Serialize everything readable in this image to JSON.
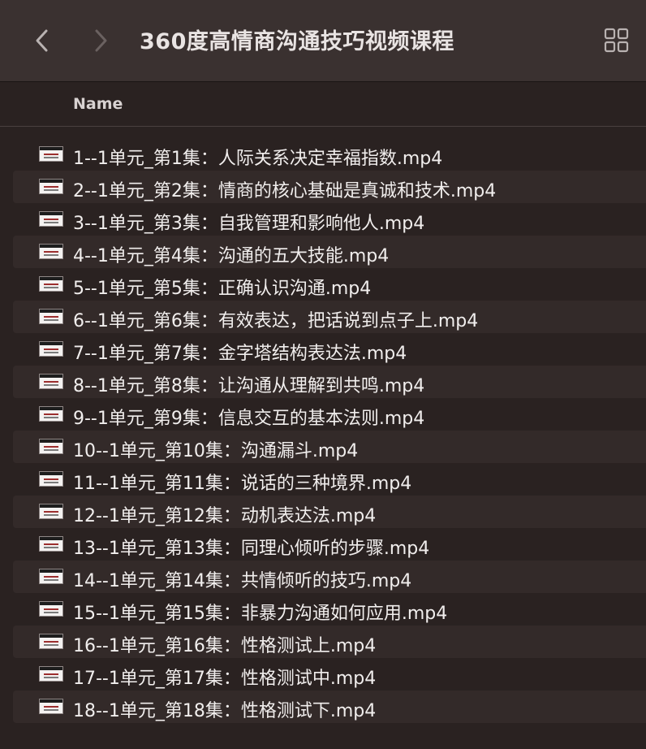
{
  "window": {
    "title": "360度高情商沟通技巧视频课程"
  },
  "toolbar": {
    "back_icon": "chevron-left-icon",
    "forward_icon": "chevron-right-icon",
    "view_icon": "grid-view-icon"
  },
  "list_header": {
    "name": "Name"
  },
  "files": [
    "1--1单元_第1集：人际关系决定幸福指数.mp4",
    "2--1单元_第2集：情商的核心基础是真诚和技术.mp4",
    "3--1单元_第3集：自我管理和影响他人.mp4",
    "4--1单元_第4集：沟通的五大技能.mp4",
    "5--1单元_第5集：正确认识沟通.mp4",
    "6--1单元_第6集：有效表达，把话说到点子上.mp4",
    "7--1单元_第7集：金字塔结构表达法.mp4",
    "8--1单元_第8集：让沟通从理解到共鸣.mp4",
    "9--1单元_第9集：信息交互的基本法则.mp4",
    "10--1单元_第10集：沟通漏斗.mp4",
    "11--1单元_第11集：说话的三种境界.mp4",
    "12--1单元_第12集：动机表达法.mp4",
    "13--1单元_第13集：同理心倾听的步骤.mp4",
    "14--1单元_第14集：共情倾听的技巧.mp4",
    "15--1单元_第15集：非暴力沟通如何应用.mp4",
    "16--1单元_第16集：性格测试上.mp4",
    "17--1单元_第17集：性格测试中.mp4",
    "18--1单元_第18集：性格测试下.mp4"
  ]
}
